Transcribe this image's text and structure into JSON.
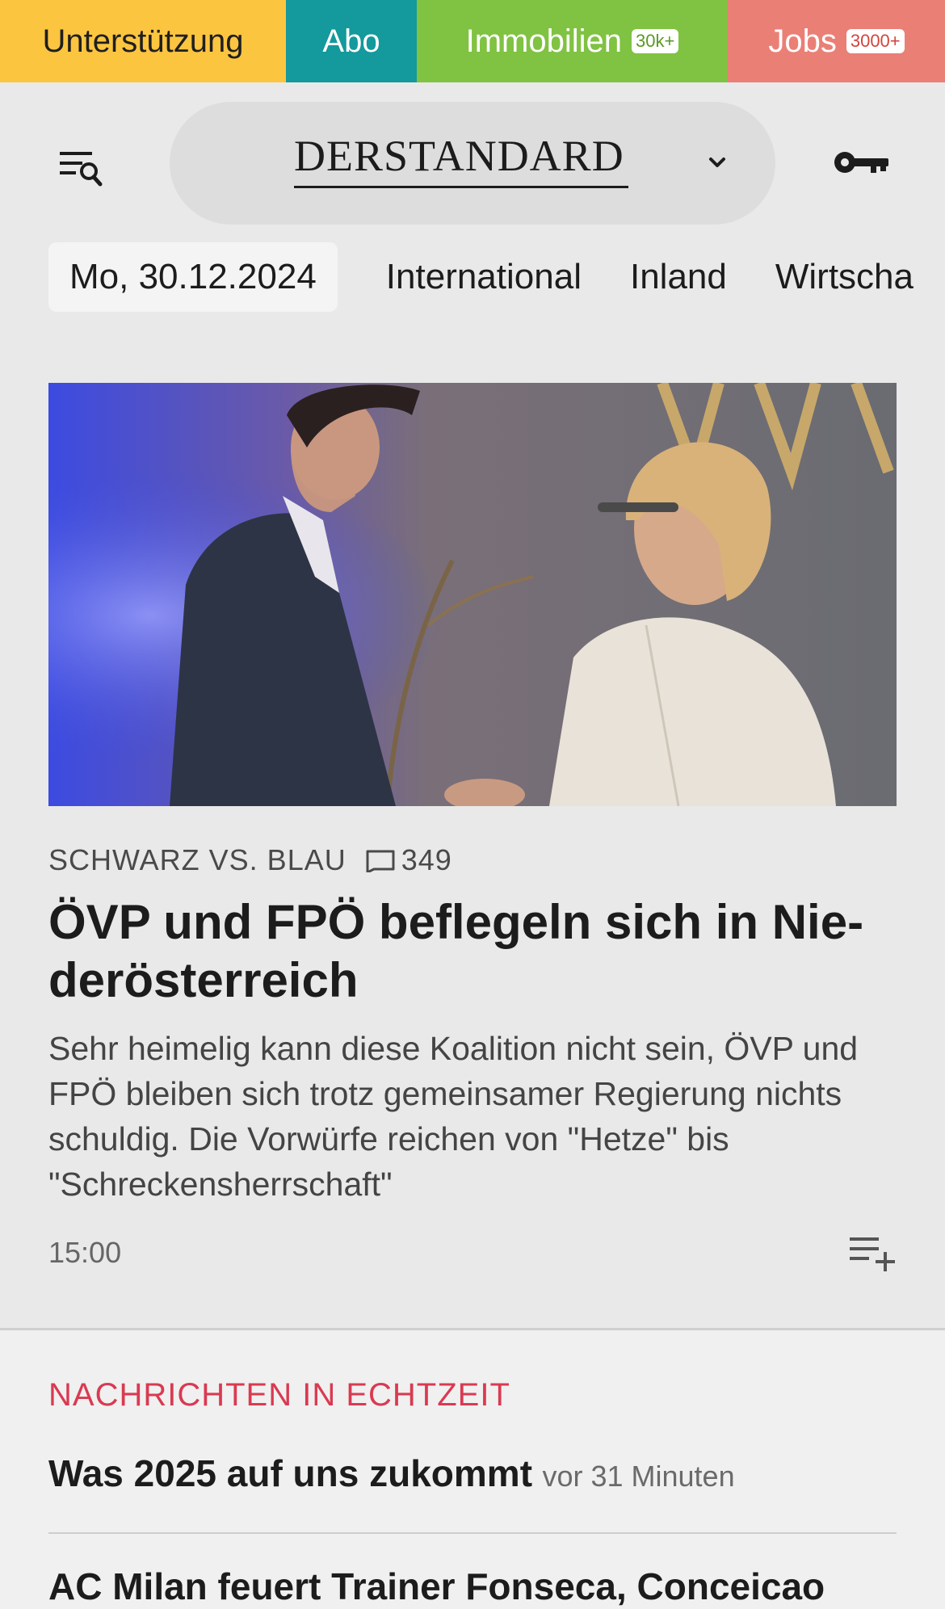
{
  "topbar": {
    "support": "Unterstützung",
    "abo": "Abo",
    "immobilien": "Immobilien",
    "immobilien_badge": "30k+",
    "jobs": "Jobs",
    "jobs_badge": "3000+",
    "colors": {
      "support": "#fcc540",
      "abo": "#14999c",
      "immobilien": "#80c242",
      "jobs": "#ea7f76"
    }
  },
  "header": {
    "logo": "DERSTANDARD",
    "icons": [
      "menu-search-icon",
      "chevron-down-icon",
      "key-icon"
    ]
  },
  "nav": {
    "date": "Mo, 30.12.2024",
    "items": [
      "International",
      "Inland",
      "Wirtscha"
    ]
  },
  "article": {
    "kicker": "SCHWARZ VS. BLAU",
    "comments": "349",
    "headline": "ÖVP und FPÖ beflegeln sich in Nie-derösterreich",
    "teaser": "Sehr heimelig kann diese Koalition nicht sein, ÖVP und FPÖ bleiben sich trotz gemeinsamer Regierung nichts schuldig. Die Vorwürfe reichen von \"Hetze\" bis \"Schreckensherrschaft\"",
    "time": "15:00"
  },
  "live": {
    "heading": "NACHRICHTEN IN ECHTZEIT",
    "accent": "#d93a52",
    "items": [
      {
        "title": "Was 2025 auf uns zukommt",
        "time": "vor 31 Minuten"
      },
      {
        "title": "AC Milan feuert Trainer Fonseca, Conceicao",
        "time": ""
      }
    ]
  }
}
